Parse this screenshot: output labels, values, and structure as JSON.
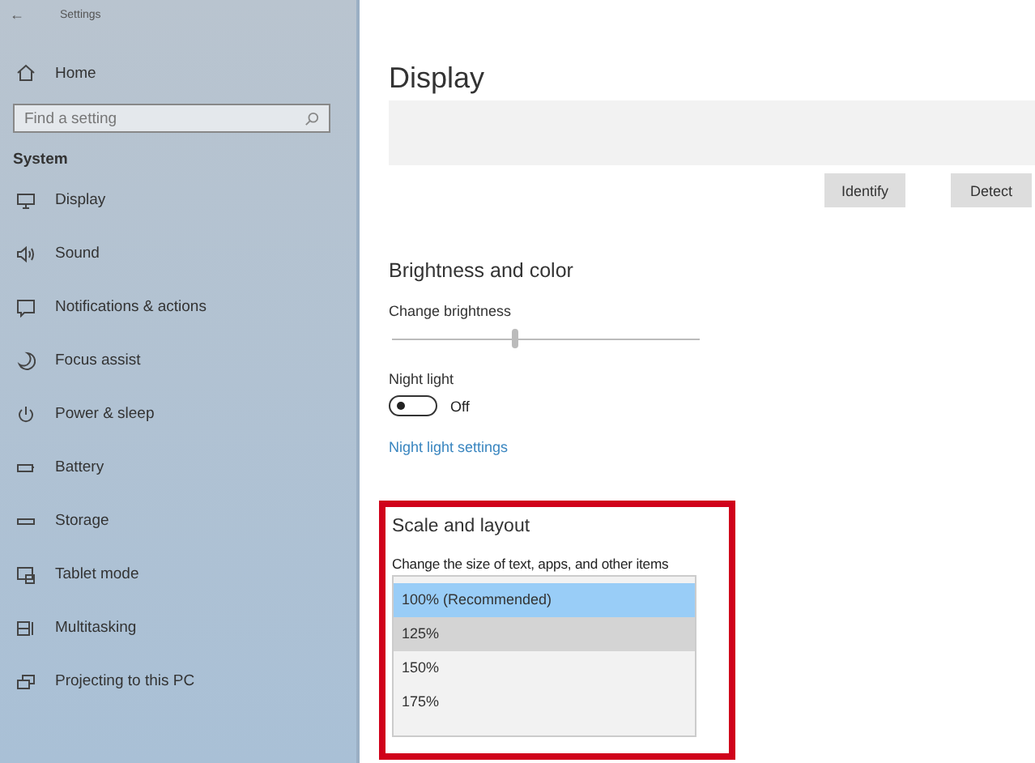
{
  "window": {
    "title": "Settings",
    "back": "←"
  },
  "sidebar": {
    "home": "Home",
    "search": {
      "placeholder": "Find a setting"
    },
    "section": "System",
    "items": [
      {
        "label": "Display",
        "kind": "display"
      },
      {
        "label": "Sound",
        "kind": "sound"
      },
      {
        "label": "Notifications & actions",
        "kind": "notifications"
      },
      {
        "label": "Focus assist",
        "kind": "moon"
      },
      {
        "label": "Power & sleep",
        "kind": "power"
      },
      {
        "label": "Battery",
        "kind": "battery"
      },
      {
        "label": "Storage",
        "kind": "storage"
      },
      {
        "label": "Tablet mode",
        "kind": "tablet"
      },
      {
        "label": "Multitasking",
        "kind": "multitask"
      },
      {
        "label": "Projecting to this PC",
        "kind": "project"
      }
    ]
  },
  "main": {
    "title": "Display",
    "buttons": [
      "Identify",
      "Detect"
    ],
    "brightness": {
      "heading": "Brightness and color",
      "slider_label": "Change brightness",
      "level": 0.4,
      "night_light_label": "Night light",
      "night_light_on": false,
      "night_light_state": "Off",
      "link": "Night light settings"
    },
    "scale": {
      "heading": "Scale and layout",
      "label": "Change the size of text, apps, and other items",
      "options": [
        {
          "label": "100% (Recommended)",
          "selected": true,
          "hovered": false
        },
        {
          "label": "125%",
          "selected": false,
          "hovered": true
        },
        {
          "label": "150%",
          "selected": false,
          "hovered": false
        },
        {
          "label": "175%",
          "selected": false,
          "hovered": false
        }
      ]
    }
  }
}
